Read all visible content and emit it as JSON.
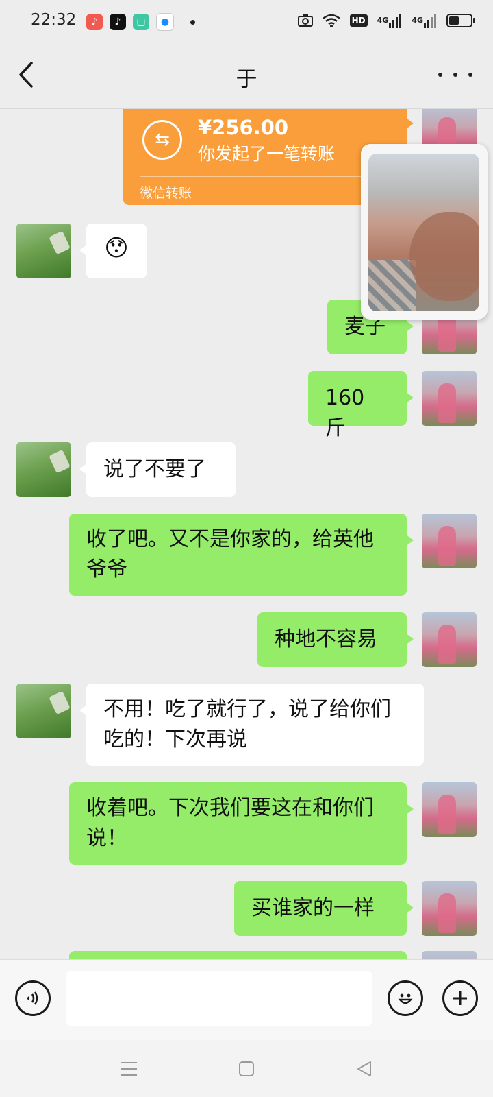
{
  "status_bar": {
    "time": "22:32",
    "app_icons": [
      "music-app-icon",
      "tiktok-icon",
      "chat-app-icon",
      "browser-icon"
    ],
    "system_icons": [
      "camera-icon",
      "wifi-icon",
      "hd-icon",
      "signal-4g-icon",
      "signal-4g-icon",
      "battery-icon"
    ],
    "hd_label": "HD",
    "network_label": "4G"
  },
  "header": {
    "title": "于"
  },
  "messages": [
    {
      "side": "right",
      "type": "transfer",
      "amount": "¥256.00",
      "description": "你发起了一笔转账",
      "label": "微信转账"
    },
    {
      "side": "left",
      "type": "emoji",
      "emoji": "😯"
    },
    {
      "side": "right",
      "type": "text",
      "text": "麦子"
    },
    {
      "side": "right",
      "type": "text",
      "text": "160 斤"
    },
    {
      "side": "left",
      "type": "text",
      "text": "说了不要了"
    },
    {
      "side": "right",
      "type": "text",
      "text": "收了吧。又不是你家的，给英他爷爷"
    },
    {
      "side": "right",
      "type": "text",
      "text": "种地不容易"
    },
    {
      "side": "left",
      "type": "text",
      "text": "不用！吃了就行了，说了给你们吃的！下次再说"
    },
    {
      "side": "right",
      "type": "text",
      "text": "收着吧。下次我们要这在和你们说！"
    },
    {
      "side": "right",
      "type": "text",
      "text": "买谁家的一样"
    }
  ],
  "input_bar": {
    "text_value": "",
    "voice_icon": "voice-icon",
    "emoji_icon": "emoji-icon",
    "plus_icon": "plus-icon"
  },
  "colors": {
    "sent_bubble": "#95ec69",
    "received_bubble": "#ffffff",
    "transfer_card": "#f99e3a",
    "background": "#ededed"
  }
}
